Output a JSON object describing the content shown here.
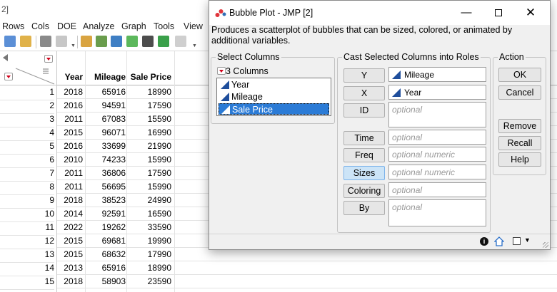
{
  "background_window": {
    "title_fragment": "2]",
    "menu": [
      "Rows",
      "Cols",
      "DOE",
      "Analyze",
      "Graph",
      "Tools",
      "View"
    ],
    "table": {
      "columns": [
        "Year",
        "Mileage",
        "Sale Price"
      ],
      "rows": [
        {
          "n": "1",
          "year": "2018",
          "mileage": "65916",
          "price": "18990"
        },
        {
          "n": "2",
          "year": "2016",
          "mileage": "94591",
          "price": "17590"
        },
        {
          "n": "3",
          "year": "2011",
          "mileage": "67083",
          "price": "15590"
        },
        {
          "n": "4",
          "year": "2015",
          "mileage": "96071",
          "price": "16990"
        },
        {
          "n": "5",
          "year": "2016",
          "mileage": "33699",
          "price": "21990"
        },
        {
          "n": "6",
          "year": "2010",
          "mileage": "74233",
          "price": "15990"
        },
        {
          "n": "7",
          "year": "2011",
          "mileage": "36806",
          "price": "17590"
        },
        {
          "n": "8",
          "year": "2011",
          "mileage": "56695",
          "price": "15990"
        },
        {
          "n": "9",
          "year": "2018",
          "mileage": "38523",
          "price": "24990"
        },
        {
          "n": "10",
          "year": "2014",
          "mileage": "92591",
          "price": "16590"
        },
        {
          "n": "11",
          "year": "2022",
          "mileage": "19262",
          "price": "33590"
        },
        {
          "n": "12",
          "year": "2015",
          "mileage": "69681",
          "price": "19990"
        },
        {
          "n": "13",
          "year": "2015",
          "mileage": "68632",
          "price": "17990"
        },
        {
          "n": "14",
          "year": "2013",
          "mileage": "65916",
          "price": "18990"
        },
        {
          "n": "15",
          "year": "2018",
          "mileage": "58903",
          "price": "23590"
        }
      ]
    }
  },
  "dialog": {
    "title": "Bubble Plot - JMP [2]",
    "description": "Produces a scatterplot of bubbles that can be sized, colored, or animated by additional variables.",
    "select_columns": {
      "label": "Select Columns",
      "count": "3 Columns",
      "items": [
        "Year",
        "Mileage",
        "Sale Price"
      ],
      "selected": "Sale Price"
    },
    "roles": {
      "label": "Cast Selected Columns into Roles",
      "y": {
        "button": "Y",
        "value": "Mileage"
      },
      "x": {
        "button": "X",
        "value": "Year"
      },
      "id": {
        "button": "ID",
        "placeholder": "optional"
      },
      "time": {
        "button": "Time",
        "placeholder": "optional"
      },
      "freq": {
        "button": "Freq",
        "placeholder": "optional numeric"
      },
      "sizes": {
        "button": "Sizes",
        "placeholder": "optional numeric"
      },
      "coloring": {
        "button": "Coloring",
        "placeholder": "optional"
      },
      "by": {
        "button": "By",
        "placeholder": "optional"
      }
    },
    "action": {
      "label": "Action",
      "ok": "OK",
      "cancel": "Cancel",
      "remove": "Remove",
      "recall": "Recall",
      "help": "Help"
    },
    "status_icons": [
      "info-icon",
      "home-icon",
      "checkbox-icon",
      "dropdown-icon"
    ]
  },
  "colors": {
    "selection": "#2b7bd6",
    "active_role": "#cce4f7",
    "red_triangle": "#d0021b",
    "continuous_icon": "#1f4e9c"
  }
}
